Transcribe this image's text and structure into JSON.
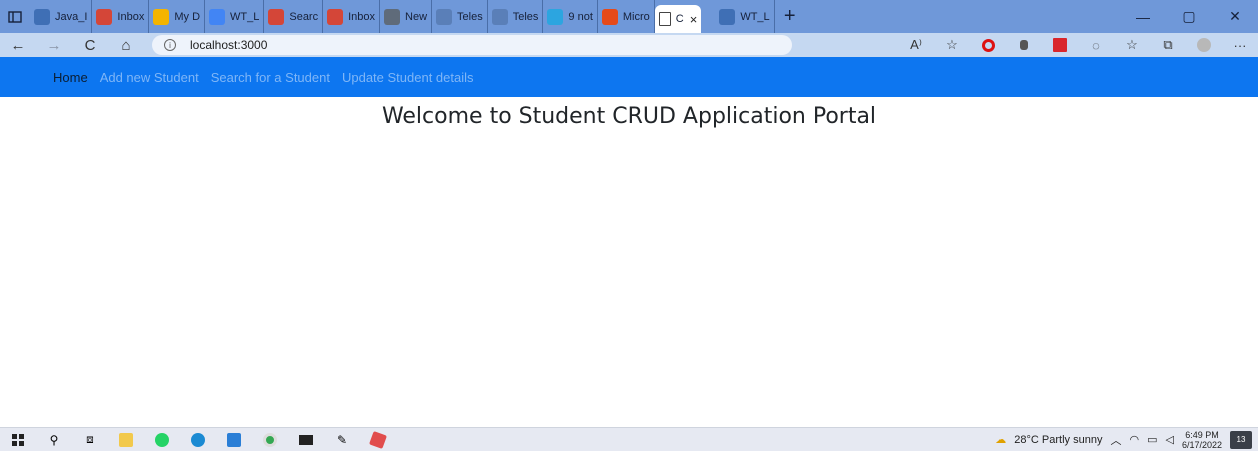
{
  "browser": {
    "tabs": [
      {
        "label": "Java_I",
        "icon": "document-icon",
        "color": "#3f6fb5"
      },
      {
        "label": "Inbox",
        "icon": "gmail-icon",
        "color": "#d44638"
      },
      {
        "label": "My D",
        "icon": "drive-icon",
        "color": "#f4b400"
      },
      {
        "label": "WT_L",
        "icon": "docs-icon",
        "color": "#4285f4"
      },
      {
        "label": "Searc",
        "icon": "gmail-icon",
        "color": "#d44638"
      },
      {
        "label": "Inbox",
        "icon": "gmail-icon",
        "color": "#d44638"
      },
      {
        "label": "New",
        "icon": "page-icon",
        "color": "#5f6b7a"
      },
      {
        "label": "Teles",
        "icon": "telescope-icon",
        "color": "#5a7fb8"
      },
      {
        "label": "Teles",
        "icon": "telescope-icon",
        "color": "#5a7fb8"
      },
      {
        "label": "9 not",
        "icon": "send-icon",
        "color": "#2ca5e0"
      },
      {
        "label": "Micro",
        "icon": "office-icon",
        "color": "#e64a19"
      }
    ],
    "active_tab": {
      "label": "C",
      "icon": "page-icon",
      "close": "×"
    },
    "trailing_tab": {
      "label": "WT_L",
      "icon": "document-icon"
    },
    "new_tab": "+",
    "window_controls": {
      "minimize": "—",
      "maximize": "▢",
      "close": "✕"
    },
    "nav": {
      "back": "←",
      "forward": "→",
      "refresh": "C",
      "home": "⌂"
    },
    "url": "localhost:3000",
    "info_icon": "i",
    "toolbar": {
      "read_aloud": "A⁾",
      "more": "···"
    }
  },
  "page": {
    "nav_links": [
      {
        "label": "Home",
        "active": true
      },
      {
        "label": "Add new Student",
        "active": false
      },
      {
        "label": "Search for a Student",
        "active": false
      },
      {
        "label": "Update Student details",
        "active": false
      }
    ],
    "heading": "Welcome to Student CRUD Application Portal"
  },
  "taskbar": {
    "weather": "28°C  Partly sunny",
    "time": "6:49 PM",
    "date": "6/17/2022",
    "notifications": "13",
    "colors": {
      "accent": "#0d76f0"
    }
  }
}
